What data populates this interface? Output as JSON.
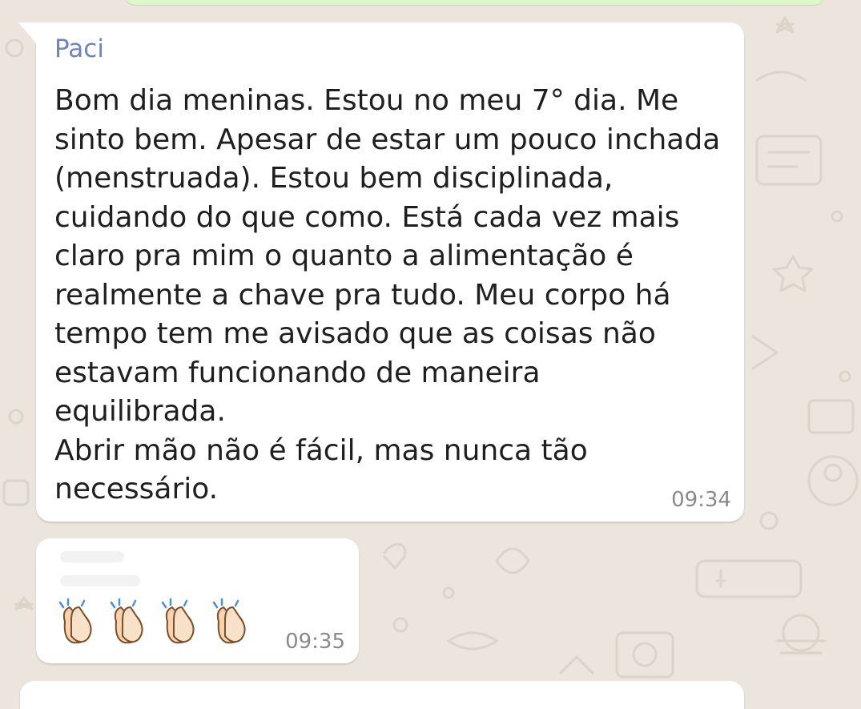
{
  "chat": {
    "messages": [
      {
        "sender": "Paci",
        "text": "Bom dia meninas. Estou no meu 7° dia. Me\nsinto bem. Apesar de estar um pouco inchada\n(menstruada). Estou bem disciplinada,\ncuidando do que como. Está cada vez mais\nclaro pra mim o quanto a alimentação é\nrealmente a chave pra tudo. Meu corpo há\ntempo tem me avisado que as coisas não\nestavam funcionando de maneira\nequilibrada.\nAbrir mão não é fácil, mas nunca tão\nnecessário.",
        "time": "09:34"
      },
      {
        "emojis": [
          "clapping-hands",
          "clapping-hands",
          "clapping-hands",
          "clapping-hands"
        ],
        "time": "09:35"
      }
    ]
  },
  "colors": {
    "background": "#ece5dd",
    "incoming_bubble": "#ffffff",
    "outgoing_bubble": "#dcf8c6",
    "sender_name": "#6f86b8",
    "timestamp": "#8a8a8a"
  }
}
